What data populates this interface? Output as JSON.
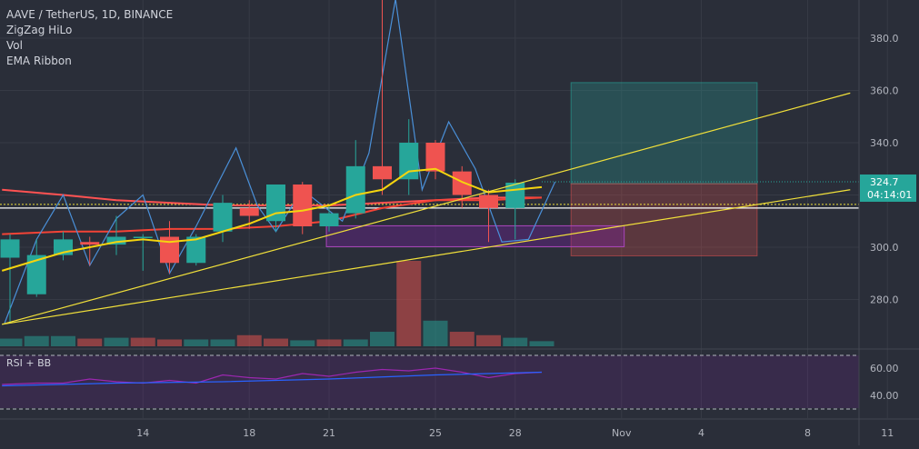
{
  "chart_data": {
    "type": "candlestick",
    "title": "AAVE / TetherUS, 1D, BINANCE",
    "indicators": [
      "ZigZag HiLo",
      "Vol",
      "EMA Ribbon"
    ],
    "rsi_label": "RSI + BB",
    "price_axis": {
      "ticks": [
        "380.0",
        "360.0",
        "340.0",
        "300.0",
        "280.0"
      ],
      "tick_values": [
        380,
        360,
        340,
        300,
        280
      ]
    },
    "rsi_axis": {
      "ticks": [
        "60.00",
        "40.00"
      ],
      "tick_values": [
        60,
        40
      ]
    },
    "x_axis": {
      "ticks": [
        "14",
        "18",
        "21",
        "25",
        "28",
        "Nov",
        "4",
        "8",
        "11"
      ],
      "tick_index": [
        5,
        9,
        12,
        16,
        19,
        23,
        26,
        30,
        33
      ]
    },
    "last_price": "324.7",
    "countdown": "04:14:01",
    "candles": [
      {
        "i": 0,
        "o": 296,
        "h": 305,
        "l": 271,
        "c": 303
      },
      {
        "i": 1,
        "o": 282,
        "h": 303,
        "l": 281,
        "c": 297
      },
      {
        "i": 2,
        "o": 297,
        "h": 306,
        "l": 295,
        "c": 303
      },
      {
        "i": 3,
        "o": 302,
        "h": 304,
        "l": 293,
        "c": 301
      },
      {
        "i": 4,
        "o": 301,
        "h": 312,
        "l": 297,
        "c": 304
      },
      {
        "i": 5,
        "o": 304,
        "h": 305,
        "l": 291,
        "c": 304
      },
      {
        "i": 6,
        "o": 304,
        "h": 310,
        "l": 290,
        "c": 294
      },
      {
        "i": 7,
        "o": 294,
        "h": 305,
        "l": 293,
        "c": 304
      },
      {
        "i": 8,
        "o": 306,
        "h": 320,
        "l": 302,
        "c": 317
      },
      {
        "i": 9,
        "o": 315,
        "h": 318,
        "l": 307,
        "c": 312
      },
      {
        "i": 10,
        "o": 310,
        "h": 324,
        "l": 306,
        "c": 324
      },
      {
        "i": 11,
        "o": 324,
        "h": 325,
        "l": 305,
        "c": 308
      },
      {
        "i": 12,
        "o": 308,
        "h": 316,
        "l": 306,
        "c": 313
      },
      {
        "i": 13,
        "o": 313,
        "h": 341,
        "l": 311,
        "c": 331
      },
      {
        "i": 14,
        "o": 331,
        "h": 395,
        "l": 320,
        "c": 326
      },
      {
        "i": 15,
        "o": 326,
        "h": 349,
        "l": 320,
        "c": 340
      },
      {
        "i": 16,
        "o": 340,
        "h": 341,
        "l": 326,
        "c": 329
      },
      {
        "i": 17,
        "o": 329,
        "h": 331,
        "l": 315,
        "c": 320
      },
      {
        "i": 18,
        "o": 320,
        "h": 322,
        "l": 302,
        "c": 315
      },
      {
        "i": 19,
        "o": 315,
        "h": 326,
        "l": 303,
        "c": 324.7
      }
    ],
    "volume": [
      {
        "i": 0,
        "v": 0.09,
        "d": "up"
      },
      {
        "i": 1,
        "v": 0.12,
        "d": "up"
      },
      {
        "i": 2,
        "v": 0.12,
        "d": "up"
      },
      {
        "i": 3,
        "v": 0.09,
        "d": "down"
      },
      {
        "i": 4,
        "v": 0.1,
        "d": "up"
      },
      {
        "i": 5,
        "v": 0.1,
        "d": "down"
      },
      {
        "i": 6,
        "v": 0.08,
        "d": "down"
      },
      {
        "i": 7,
        "v": 0.08,
        "d": "up"
      },
      {
        "i": 8,
        "v": 0.08,
        "d": "up"
      },
      {
        "i": 9,
        "v": 0.13,
        "d": "down"
      },
      {
        "i": 10,
        "v": 0.09,
        "d": "down"
      },
      {
        "i": 11,
        "v": 0.07,
        "d": "up"
      },
      {
        "i": 12,
        "v": 0.08,
        "d": "down"
      },
      {
        "i": 13,
        "v": 0.08,
        "d": "up"
      },
      {
        "i": 14,
        "v": 0.17,
        "d": "up"
      },
      {
        "i": 15,
        "v": 1.0,
        "d": "down"
      },
      {
        "i": 16,
        "v": 0.3,
        "d": "up"
      },
      {
        "i": 17,
        "v": 0.17,
        "d": "down"
      },
      {
        "i": 18,
        "v": 0.13,
        "d": "down"
      },
      {
        "i": 19,
        "v": 0.1,
        "d": "up"
      },
      {
        "i": 20,
        "v": 0.06,
        "d": "up"
      }
    ],
    "trendlines": [
      {
        "from": [
          -0.3,
          270.5
        ],
        "to": [
          31.6,
          359
        ]
      },
      {
        "from": [
          -0.3,
          270.5
        ],
        "to": [
          31.6,
          322
        ]
      }
    ],
    "zigzag": [
      [
        -0.2,
        271
      ],
      [
        1.0,
        303
      ],
      [
        2.0,
        320
      ],
      [
        3.0,
        293
      ],
      [
        4.0,
        311
      ],
      [
        5.0,
        320
      ],
      [
        6.0,
        290
      ],
      [
        7.0,
        308
      ],
      [
        8.5,
        338
      ],
      [
        9.3,
        316
      ],
      [
        10.0,
        306
      ],
      [
        11.0,
        322
      ],
      [
        12.5,
        310
      ],
      [
        13.5,
        336
      ],
      [
        14.5,
        395
      ],
      [
        15.5,
        322
      ],
      [
        16.5,
        348
      ],
      [
        17.5,
        330
      ],
      [
        18.5,
        302
      ],
      [
        19.5,
        303
      ],
      [
        20.5,
        325
      ]
    ],
    "ema_fast": [
      [
        -0.3,
        291
      ],
      [
        1,
        295
      ],
      [
        2,
        298
      ],
      [
        3,
        300
      ],
      [
        4,
        302
      ],
      [
        5,
        303
      ],
      [
        6,
        302
      ],
      [
        7,
        303
      ],
      [
        8,
        306
      ],
      [
        9,
        309
      ],
      [
        10,
        313
      ],
      [
        11,
        314
      ],
      [
        12,
        316
      ],
      [
        13,
        320
      ],
      [
        14,
        322
      ],
      [
        15,
        329
      ],
      [
        16,
        330
      ],
      [
        17,
        325
      ],
      [
        18,
        321
      ],
      [
        19,
        322
      ],
      [
        20,
        323
      ]
    ],
    "ema_slow": [
      [
        -0.3,
        305
      ],
      [
        2,
        306
      ],
      [
        4,
        306
      ],
      [
        6,
        307
      ],
      [
        8,
        307
      ],
      [
        10,
        308
      ],
      [
        12,
        310
      ],
      [
        14,
        315
      ],
      [
        16,
        318
      ],
      [
        18,
        318
      ],
      [
        20,
        319
      ]
    ],
    "ema_long": [
      [
        -0.3,
        322
      ],
      [
        2,
        320
      ],
      [
        4,
        318
      ],
      [
        6,
        317
      ],
      [
        8,
        316
      ],
      [
        10,
        316
      ],
      [
        12,
        316
      ],
      [
        14,
        317
      ],
      [
        16,
        318
      ],
      [
        18,
        319
      ],
      [
        20,
        319
      ]
    ],
    "hline": 315,
    "support_zone": {
      "i0": 11.9,
      "i1": 23.1,
      "y0": 300.2,
      "y1": 308.2
    },
    "long_position": {
      "i0": 21.1,
      "i1": 28.1,
      "entry": 324.3,
      "target": 363,
      "stop": 296.7
    },
    "rsi": [
      [
        -0.3,
        48
      ],
      [
        1,
        49
      ],
      [
        2,
        49
      ],
      [
        3,
        52
      ],
      [
        4,
        50
      ],
      [
        5,
        49
      ],
      [
        6,
        51
      ],
      [
        7,
        49
      ],
      [
        8,
        55
      ],
      [
        9,
        53
      ],
      [
        10,
        52
      ],
      [
        11,
        56
      ],
      [
        12,
        54
      ],
      [
        13,
        57
      ],
      [
        14,
        59
      ],
      [
        15,
        58
      ],
      [
        16,
        60
      ],
      [
        17,
        57
      ],
      [
        18,
        53
      ],
      [
        19,
        56
      ],
      [
        20,
        57
      ]
    ],
    "rsi_ma": [
      [
        -0.3,
        47
      ],
      [
        4,
        49
      ],
      [
        8,
        50
      ],
      [
        12,
        52
      ],
      [
        16,
        55
      ],
      [
        20,
        57
      ]
    ]
  },
  "colors": {
    "bg": "#2a2e39",
    "grid": "#363a45",
    "up": "#26a69a",
    "down": "#ef5350",
    "text": "#d1d4dc",
    "axis_text": "#b2b5be",
    "trend": "#f1e03a",
    "ema_fast": "#f5d40f",
    "ema_slow": "#f44336",
    "ema_long": "#ff5252",
    "zigzag": "#4a90d9",
    "zone": "#7b1fa2",
    "rsi": "#9c27b0",
    "rsi_ma": "#2962ff",
    "price_label": "#26a69a"
  }
}
